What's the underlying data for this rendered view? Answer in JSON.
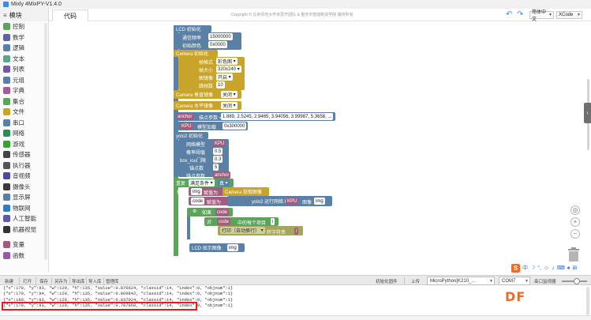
{
  "window": {
    "title": "Mixly 4MixPY-V1.4.0"
  },
  "header": {
    "categories_title": "模块",
    "code_tab": "代码",
    "copyright": "Copyright © 北京师范大学米思齐团队 & 重庆市智能制造学院 版权所有",
    "language": "简体中文",
    "theme": "XCode"
  },
  "sidebar": {
    "items": [
      {
        "label": "控制",
        "icon": "control-icon",
        "color": "#5ba55b"
      },
      {
        "label": "数学",
        "icon": "math-icon",
        "color": "#5b67a5"
      },
      {
        "label": "逻辑",
        "icon": "logic-icon",
        "color": "#5b80a5"
      },
      {
        "label": "文本",
        "icon": "text-icon",
        "color": "#5ba58c"
      },
      {
        "label": "列表",
        "icon": "list-icon",
        "color": "#745ba5"
      },
      {
        "label": "元组",
        "icon": "tuple-icon",
        "color": "#5b80a5"
      },
      {
        "label": "字典",
        "icon": "dict-icon",
        "color": "#a55b99"
      },
      {
        "label": "集合",
        "icon": "set-icon",
        "color": "#5ba55b"
      },
      {
        "label": "文件",
        "icon": "file-icon",
        "color": "#c9a42a"
      },
      {
        "label": "串口",
        "icon": "serial-icon",
        "color": "#5b80a5"
      },
      {
        "label": "网络",
        "icon": "network-icon",
        "color": "#2e8b57"
      },
      {
        "label": "游戏",
        "icon": "game-icon",
        "color": "#33a333"
      },
      {
        "label": "传感器",
        "icon": "sensor-icon",
        "color": "#444444"
      },
      {
        "label": "执行器",
        "icon": "actuator-icon",
        "color": "#555555"
      },
      {
        "label": "音视频",
        "icon": "media-icon",
        "color": "#4a4a9a"
      },
      {
        "label": "摄像头",
        "icon": "camera-icon",
        "color": "#3a3a3a"
      },
      {
        "label": "显示屏",
        "icon": "display-icon",
        "color": "#5b80a5"
      },
      {
        "label": "物联网",
        "icon": "iot-icon",
        "color": "#2f7fbf"
      },
      {
        "label": "人工智能",
        "icon": "ai-icon",
        "color": "#5b5ba5"
      },
      {
        "label": "机器视觉",
        "icon": "vision-icon",
        "color": "#333333"
      },
      {
        "label": "",
        "icon": "divider",
        "color": "#ffffff"
      },
      {
        "label": "变量",
        "icon": "variable-icon",
        "color": "#a55b80"
      },
      {
        "label": "函数",
        "icon": "function-icon",
        "color": "#995ba5"
      }
    ]
  },
  "blocks": {
    "lcd_init": "LCD 初始化",
    "lcd_freq_label": "通信频率",
    "lcd_freq": "15000000",
    "lcd_color_label": "初始颜色",
    "lcd_color": "0x0000",
    "cam_init": "Camera 初始化",
    "cam_format_label": "帧格式",
    "cam_format": "彩色图",
    "cam_size_label": "帧大小",
    "cam_size": "320x240",
    "cam_flip_label": "图镜像",
    "cam_flip": "开启",
    "cam_skip_label": "跳帧数",
    "cam_skip": "10",
    "cam_vflip": "Camera 垂直镜像",
    "cam_vflip_val": "关闭",
    "cam_hmirror": "Camera 水平镜像",
    "cam_hmirror_val": "关闭",
    "anchor_label": "anchor",
    "anchor_eq": "描点参数 =",
    "anchor_vals": "1.889, 2.5245, 2.9465, 3.94056, 3.99987, 5.3658, ...",
    "kpu_var": "KPU",
    "kpu_load": "模型加载",
    "kpu_addr": "0x300000",
    "yolo_init": "yolo2 初始化",
    "net_model_label": "网络模型",
    "net_model": "KPU",
    "prob_label": "概率阈值",
    "prob": "0.5",
    "box_label": "box_iou门限",
    "box": "0.3",
    "anchor_num_label": "锚点数",
    "anchor_num": "5",
    "anchor_param_label": "锚点参数",
    "anchor_param": "anchor",
    "repeat": "重复",
    "repeat_cond": "满足条件",
    "repeat_true": "真",
    "exec": "执行",
    "img_var": "img",
    "assign": "赋值为",
    "cam_snap": "Camera 获取图像",
    "code_var": "code",
    "yolo_run": "yolo2 运行网络 模型",
    "yolo_model": "KPU",
    "yolo_image": "图像",
    "yolo_img": "img",
    "if": "如果",
    "if_code": "code",
    "exec2": "执行",
    "for": "对",
    "for_code": "code",
    "for_each": "中的每个项目",
    "for_i": "i",
    "exec3": "执行",
    "print": "打印（自动换行）",
    "to_str": "转字符串",
    "print_i": "i",
    "lcd_show": "LCD 显示图像",
    "lcd_img": "img"
  },
  "toolbar": {
    "new": "新建",
    "open": "打开",
    "save": "保存",
    "save_as": "另存为",
    "export_lib": "导出库",
    "import_lib": "导入库",
    "manage_lib": "管理库",
    "init_board": "初始化固件",
    "upload": "上传",
    "board": "MicroPython[K210_...",
    "port": "COM7",
    "serial_monitor": "串口监视器"
  },
  "output": {
    "lines": [
      "{\"x\":179, \"y\":93, \"w\":129, \"h\":135, \"value\":0.876624, \"classid\":14, \"index\":0, \"objnum\":1}",
      "{\"x\":179, \"y\":94, \"w\":129, \"h\":135, \"value\":0.869842, \"classid\":14, \"index\":0, \"objnum\":1}",
      "{\"x\":180, \"y\":93, \"w\":129, \"h\":135, \"value\":0.837024, \"classid\":14, \"index\":0, \"objnum\":1}",
      "{\"x\":179, \"y\":93, \"w\":129, \"h\":135, \"value\":0.787868, \"classid\":14, \"index\":0, \"objnum\":1}"
    ]
  },
  "overlay": {
    "ime": "中",
    "watermark": "DF"
  }
}
